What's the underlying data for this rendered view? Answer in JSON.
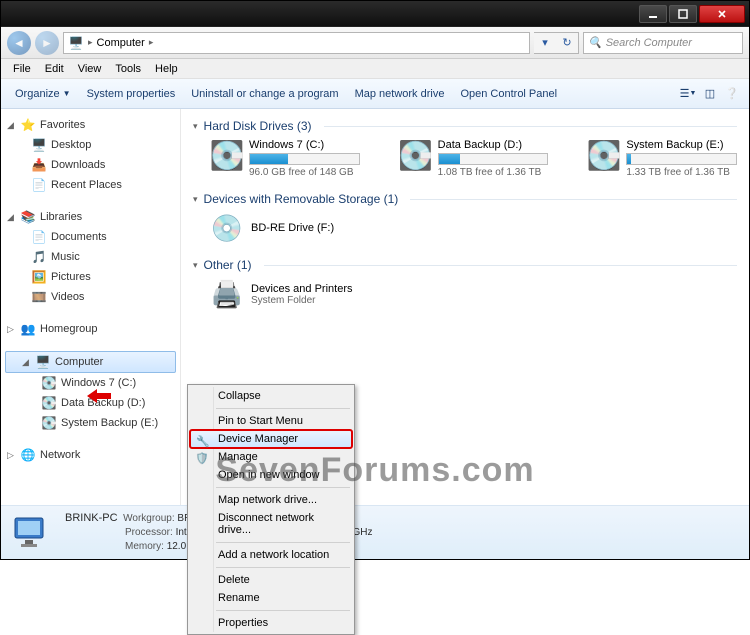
{
  "window": {
    "title": "Computer",
    "search_placeholder": "Search Computer"
  },
  "menubar": [
    "File",
    "Edit",
    "View",
    "Tools",
    "Help"
  ],
  "toolbar": {
    "organize": "Organize",
    "sysprops": "System properties",
    "uninstall": "Uninstall or change a program",
    "mapdrive": "Map network drive",
    "opencp": "Open Control Panel"
  },
  "nav": {
    "favorites": {
      "label": "Favorites",
      "items": [
        "Desktop",
        "Downloads",
        "Recent Places"
      ]
    },
    "libraries": {
      "label": "Libraries",
      "items": [
        "Documents",
        "Music",
        "Pictures",
        "Videos"
      ]
    },
    "homegroup": {
      "label": "Homegroup"
    },
    "computer": {
      "label": "Computer",
      "items": [
        "Windows 7 (C:)",
        "Data Backup (D:)",
        "System Backup (E:)"
      ]
    },
    "network": {
      "label": "Network"
    }
  },
  "sections": {
    "hdd": {
      "label": "Hard Disk Drives (3)"
    },
    "remov": {
      "label": "Devices with Removable Storage (1)"
    },
    "other": {
      "label": "Other (1)"
    }
  },
  "drives": [
    {
      "name": "Windows 7 (C:)",
      "free": "96.0 GB free of 148 GB",
      "pct": 35
    },
    {
      "name": "Data Backup (D:)",
      "free": "1.08 TB free of 1.36 TB",
      "pct": 20
    },
    {
      "name": "System Backup (E:)",
      "free": "1.33 TB free of 1.36 TB",
      "pct": 3
    }
  ],
  "removable": {
    "name": "BD-RE Drive (F:)"
  },
  "other": {
    "name": "Devices and Printers",
    "sub": "System Folder"
  },
  "ctx": {
    "collapse": "Collapse",
    "pin": "Pin to Start Menu",
    "devmgr": "Device Manager",
    "manage": "Manage",
    "opennew": "Open in new window",
    "map": "Map network drive...",
    "disc": "Disconnect network drive...",
    "addnet": "Add a network location",
    "delete": "Delete",
    "rename": "Rename",
    "props": "Properties"
  },
  "details": {
    "name": "BRINK-PC",
    "workgroup_lbl": "Workgroup:",
    "workgroup": "BRINKGROUP",
    "proc_lbl": "Processor:",
    "proc": "Intel(R) Core(TM) i7 CPU     X 980  @ 3.33GHz",
    "mem_lbl": "Memory:",
    "mem": "12.0 GB"
  },
  "watermark": "SevenForums.com"
}
